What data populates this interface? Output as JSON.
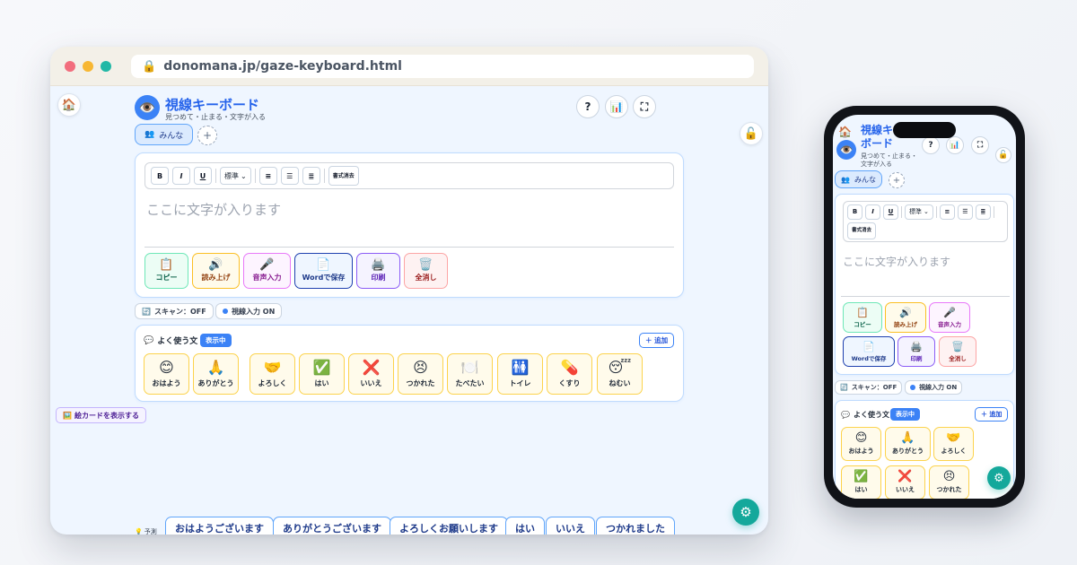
{
  "browser": {
    "url": "donomana.jp/gaze-keyboard.html"
  },
  "app": {
    "title": "視線キーボード",
    "subtitle": "見つめて・止まる・文字が入る",
    "title_mobile_line1": "視線キ",
    "title_mobile_line2": "ボード",
    "subtitle_mobile_line1": "見つめて・止まる・",
    "subtitle_mobile_line2": "文字が入る",
    "help_label": "?",
    "home_icon": "🏠",
    "logo_icon": "👁️",
    "stats_icon": "📊",
    "fullscreen_icon": "⛶",
    "lock_icon": "🔓"
  },
  "user": {
    "icon": "👥",
    "label": "みんな",
    "add_label": "+"
  },
  "toolbar": {
    "bold": "B",
    "italic": "I",
    "underline": "U",
    "size_select": "標準",
    "clear_format_line1": "書式",
    "clear_format_line2": "消去"
  },
  "editor": {
    "placeholder": "ここに文字が入ります"
  },
  "actions": [
    {
      "icon": "📋",
      "label": "コピー"
    },
    {
      "icon": "🔊",
      "label": "読み上げ"
    },
    {
      "icon": "🎤",
      "label": "音声入力"
    },
    {
      "icon": "📄",
      "label": "Wordで保存"
    },
    {
      "icon": "🖨️",
      "label": "印刷"
    },
    {
      "icon": "🗑️",
      "label": "全消し"
    }
  ],
  "status": {
    "scan_icon": "🔄",
    "scan_label": "スキャン：OFF",
    "gaze_label": "視線入力 ON"
  },
  "phrases": {
    "icon": "💬",
    "title": "よく使う文",
    "badge": "表示中",
    "add_label": "＋ 追加",
    "items": [
      {
        "emoji": "😊",
        "label": "おはよう"
      },
      {
        "emoji": "🙏",
        "label": "ありがとう"
      },
      {
        "emoji": "🤝",
        "label": "よろしく"
      },
      {
        "emoji": "✅",
        "label": "はい"
      },
      {
        "emoji": "❌",
        "label": "いいえ"
      },
      {
        "emoji": "😣",
        "label": "つかれた"
      },
      {
        "emoji": "🍽️",
        "label": "たべたい"
      },
      {
        "emoji": "🚻",
        "label": "トイレ"
      },
      {
        "emoji": "💊",
        "label": "くすり"
      },
      {
        "emoji": "😴",
        "label": "ねむい"
      }
    ]
  },
  "picture_cards": {
    "icon": "🖼️",
    "label": "絵カードを表示する"
  },
  "prediction": {
    "icon": "💡",
    "label": "予測",
    "items": [
      "おはようございます",
      "ありがとうございます",
      "よろしくお願いします",
      "はい",
      "いいえ",
      "つかれました"
    ]
  },
  "settings_icon": "⚙"
}
